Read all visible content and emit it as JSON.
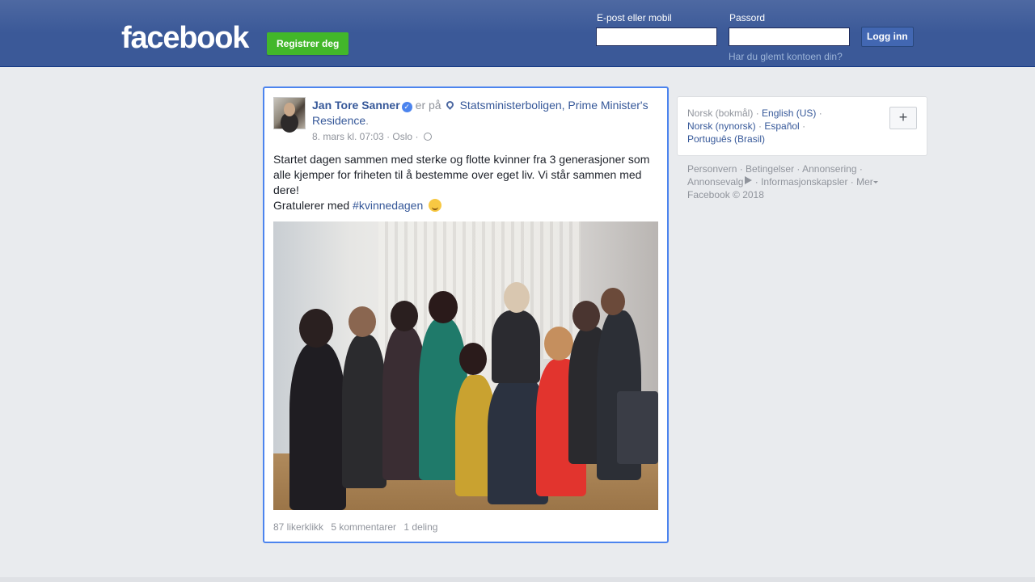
{
  "header": {
    "logo": "facebook",
    "register_label": "Registrer deg",
    "email_label": "E-post eller mobil",
    "password_label": "Passord",
    "login_label": "Logg inn",
    "forgot_link": "Har du glemt kontoen din?",
    "email_value": "",
    "password_value": ""
  },
  "post": {
    "author": "Jan Tore Sanner",
    "verified_icon": "verified-badge-icon",
    "is_at": "er på",
    "location_icon": "map-pin-icon",
    "place": "Statsministerboligen, Prime Minister's Residence",
    "place_suffix": ".",
    "date": "8. mars kl. 07:03",
    "city": "Oslo",
    "privacy_icon": "globe-icon",
    "text_line": "Startet dagen sammen med sterke og flotte kvinner fra 3 generasjoner som alle kjemper for friheten til å bestemme over eget liv. Vi står sammen med dere!",
    "text_line2_prefix": "Gratulerer med",
    "hashtag": "#kvinnedagen",
    "emoji": "smiling-face-icon",
    "likes": "87 likerklikk",
    "comments": "5 kommentarer",
    "shares": "1 deling"
  },
  "languages": {
    "current": "Norsk (bokmål)",
    "items": [
      "English (US)",
      "Norsk (nynorsk)",
      "Español",
      "Português (Brasil)"
    ],
    "more_button": "+"
  },
  "footer": {
    "links": [
      "Personvern",
      "Betingelser",
      "Annonsering",
      "Annonsevalg",
      "Informasjonskapsler",
      "Mer"
    ],
    "copyright": "Facebook © 2018"
  },
  "colors": {
    "brand": "#3b5998",
    "link": "#365899",
    "register_green": "#42b72a",
    "highlight_border": "#4c84ee"
  }
}
